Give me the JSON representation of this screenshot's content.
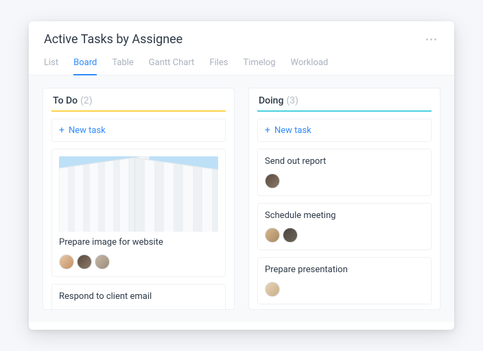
{
  "header": {
    "title": "Active Tasks by Assignee"
  },
  "tabs": [
    {
      "label": "List",
      "active": false
    },
    {
      "label": "Board",
      "active": true
    },
    {
      "label": "Table",
      "active": false
    },
    {
      "label": "Gantt Chart",
      "active": false
    },
    {
      "label": "Files",
      "active": false
    },
    {
      "label": "Timelog",
      "active": false
    },
    {
      "label": "Workload",
      "active": false
    }
  ],
  "columns": {
    "todo": {
      "title": "To Do",
      "count": "(2)",
      "accent": "#ffd24a",
      "new_task_label": "New task",
      "cards": [
        {
          "title": "Prepare image for website",
          "has_image": true,
          "avatars": [
            "a",
            "b",
            "c"
          ]
        },
        {
          "title": "Respond to client email",
          "has_image": false,
          "avatars": []
        }
      ]
    },
    "doing": {
      "title": "Doing",
      "count": "(3)",
      "accent": "#4dd0e1",
      "new_task_label": "New task",
      "cards": [
        {
          "title": "Send out report",
          "has_image": false,
          "avatars": [
            "b"
          ]
        },
        {
          "title": "Schedule meeting",
          "has_image": false,
          "avatars": [
            "d",
            "e"
          ]
        },
        {
          "title": "Prepare presentation",
          "has_image": false,
          "avatars": [
            "f"
          ]
        }
      ]
    }
  }
}
